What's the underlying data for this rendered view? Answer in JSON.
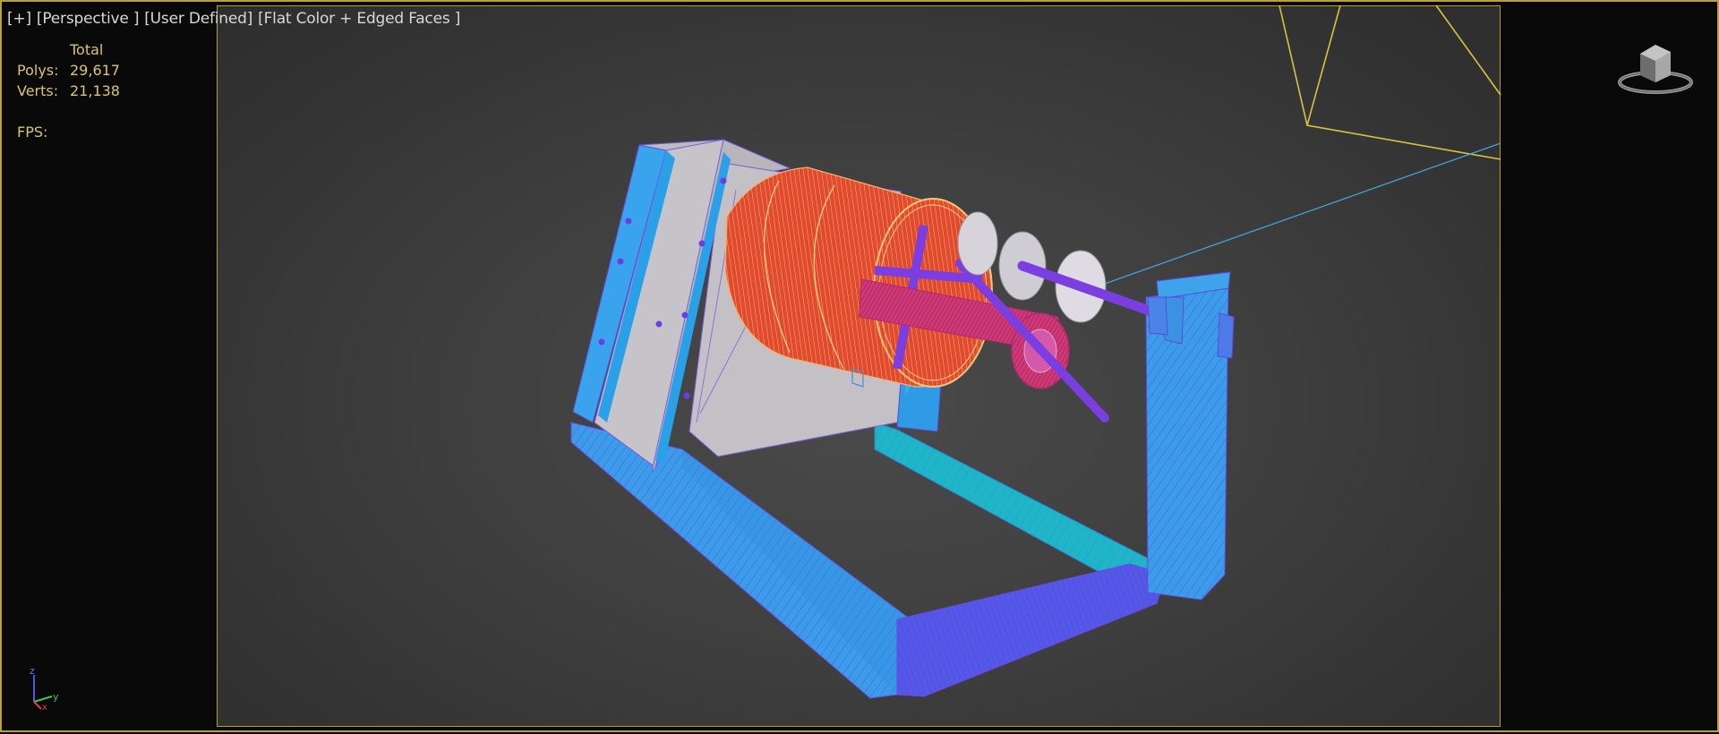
{
  "viewport": {
    "labels": [
      "[+]",
      "[Perspective ]",
      "[User Defined]",
      "[Flat Color + Edged Faces ]"
    ]
  },
  "stats": {
    "total_label": "Total",
    "polys_label": "Polys:",
    "polys_value": "29,617",
    "verts_label": "Verts:",
    "verts_value": "21,138",
    "fps_label": "FPS:"
  },
  "axis_tripod": {
    "z": "z",
    "y": "y",
    "x": "x"
  },
  "colors": {
    "frame_yellow": "#b8a13c",
    "stats_text": "#d8c56a",
    "base_blue": "#3b9cea",
    "mesh_red": "#e25036",
    "spindle_purple": "#7b3ee0",
    "panel_gray": "#c4c2c7",
    "cyan": "#1eb6c6"
  },
  "icons": {
    "viewcube": "viewcube-icon",
    "axis": "axis-tripod-icon"
  }
}
